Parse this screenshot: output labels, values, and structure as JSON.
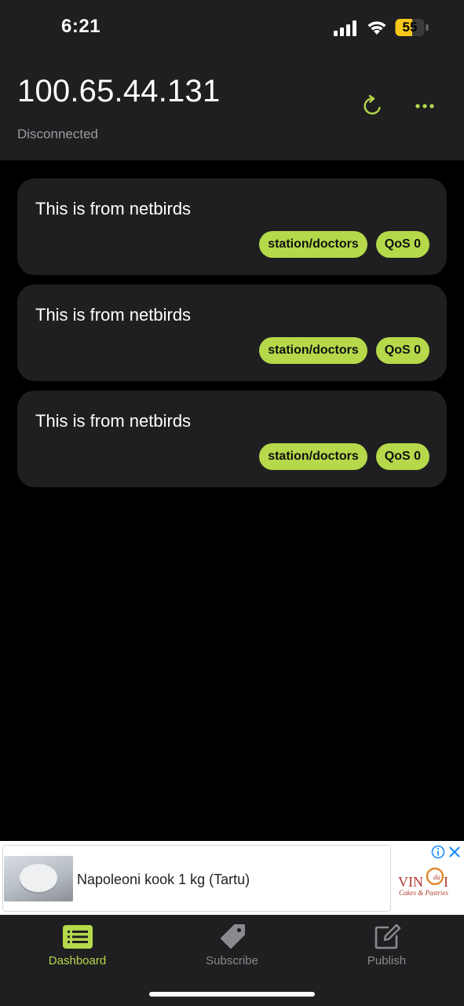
{
  "status_bar": {
    "time": "6:21",
    "battery": "55"
  },
  "header": {
    "address": "100.65.44.131",
    "status": "Disconnected",
    "refresh_icon": "refresh-icon",
    "more_icon": "more-horizontal-icon"
  },
  "messages": [
    {
      "text": "This is from netbirds",
      "topic": "station/doctors",
      "qos": "QoS 0"
    },
    {
      "text": "This is from netbirds",
      "topic": "station/doctors",
      "qos": "QoS 0"
    },
    {
      "text": "This is from netbirds",
      "topic": "station/doctors",
      "qos": "QoS 0"
    }
  ],
  "ad": {
    "title": "Napoleoni kook 1 kg (Tartu)",
    "logo_text": "VINCI",
    "logo_subtext": "Cakes & Pastries"
  },
  "nav": {
    "items": [
      {
        "label": "Dashboard",
        "icon": "list-icon",
        "active": true
      },
      {
        "label": "Subscribe",
        "icon": "tag-icon",
        "active": false
      },
      {
        "label": "Publish",
        "icon": "edit-icon",
        "active": false
      }
    ]
  },
  "colors": {
    "accent": "#b5d94a",
    "surface": "#1f1f21",
    "background": "#000000",
    "muted_text": "#9c9ca0"
  }
}
